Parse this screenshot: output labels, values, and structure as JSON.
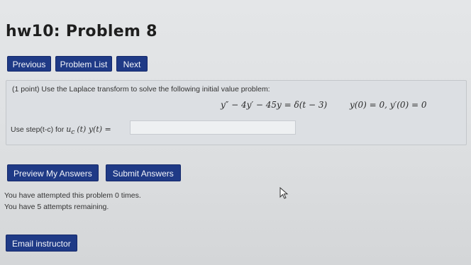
{
  "page": {
    "title": "hw10: Problem 8"
  },
  "nav": {
    "previous": "Previous",
    "problem_list": "Problem List",
    "next": "Next"
  },
  "problem": {
    "statement": "(1 point) Use the Laplace transform to solve the following initial value problem:",
    "equation": "y″ − 4y′ − 45y = δ(t − 3)",
    "initial_conditions": "y(0) = 0,  y′(0) = 0",
    "hint_prefix": "Use step(t-c) for",
    "hint_math": "u",
    "hint_sub": "c",
    "hint_suffix": "(t)  y(t) =",
    "answer_value": ""
  },
  "actions": {
    "preview": "Preview My Answers",
    "submit": "Submit Answers"
  },
  "attempts": {
    "line1": "You have attempted this problem 0 times.",
    "line2": "You have 5 attempts remaining."
  },
  "footer": {
    "email": "Email instructor"
  }
}
